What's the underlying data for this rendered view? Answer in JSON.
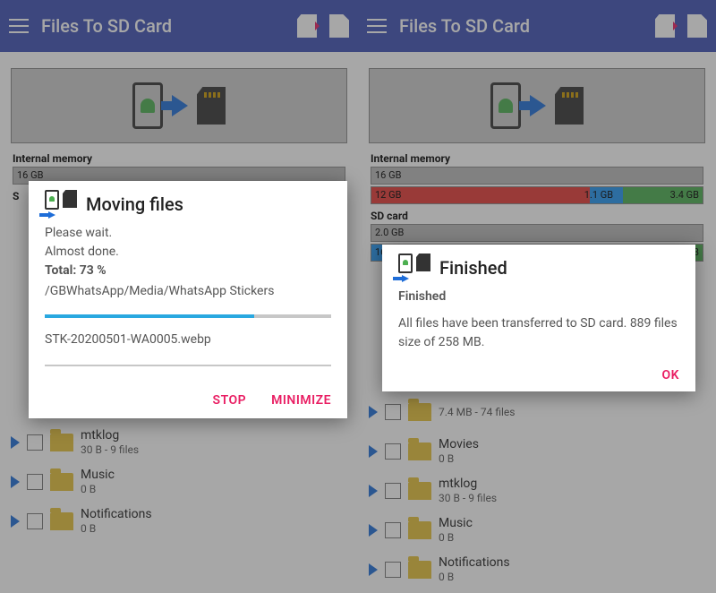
{
  "left": {
    "appbar": {
      "title": "Files To SD Card"
    },
    "internal": {
      "label": "Internal memory",
      "total": "16 GB"
    },
    "sd": {
      "label": "S"
    },
    "dialog": {
      "title": "Moving files",
      "wait": "Please wait.",
      "almost": "Almost done.",
      "total_label": "Total:",
      "total_pct": "73 %",
      "path": "/GBWhatsApp/Media/WhatsApp Stickers",
      "progress_pct": 73,
      "current_file": "STK-20200501-WA0005.webp",
      "stop": "STOP",
      "minimize": "MINIMIZE"
    },
    "files": [
      {
        "name": "mtklog",
        "sub": "30 B - 9 files"
      },
      {
        "name": "Music",
        "sub": "0 B"
      },
      {
        "name": "Notifications",
        "sub": "0 B"
      }
    ]
  },
  "right": {
    "appbar": {
      "title": "Files To SD Card"
    },
    "internal": {
      "label": "Internal memory",
      "total": "16 GB",
      "used": "12 GB",
      "seg2": "1.1 GB",
      "seg3": "3.4 GB"
    },
    "sd": {
      "label": "SD card",
      "total": "2.0 GB",
      "used": "16 MB",
      "free": "2.0 GB"
    },
    "dialog": {
      "title": "Finished",
      "subhead": "Finished",
      "body": "All files have been transferred to SD card. 889 files size of 258 MB.",
      "ok": "OK"
    },
    "files": [
      {
        "name": "",
        "sub": "7.4 MB - 74 files"
      },
      {
        "name": "Movies",
        "sub": "0 B"
      },
      {
        "name": "mtklog",
        "sub": "30 B - 9 files"
      },
      {
        "name": "Music",
        "sub": "0 B"
      },
      {
        "name": "Notifications",
        "sub": "0 B"
      }
    ]
  }
}
